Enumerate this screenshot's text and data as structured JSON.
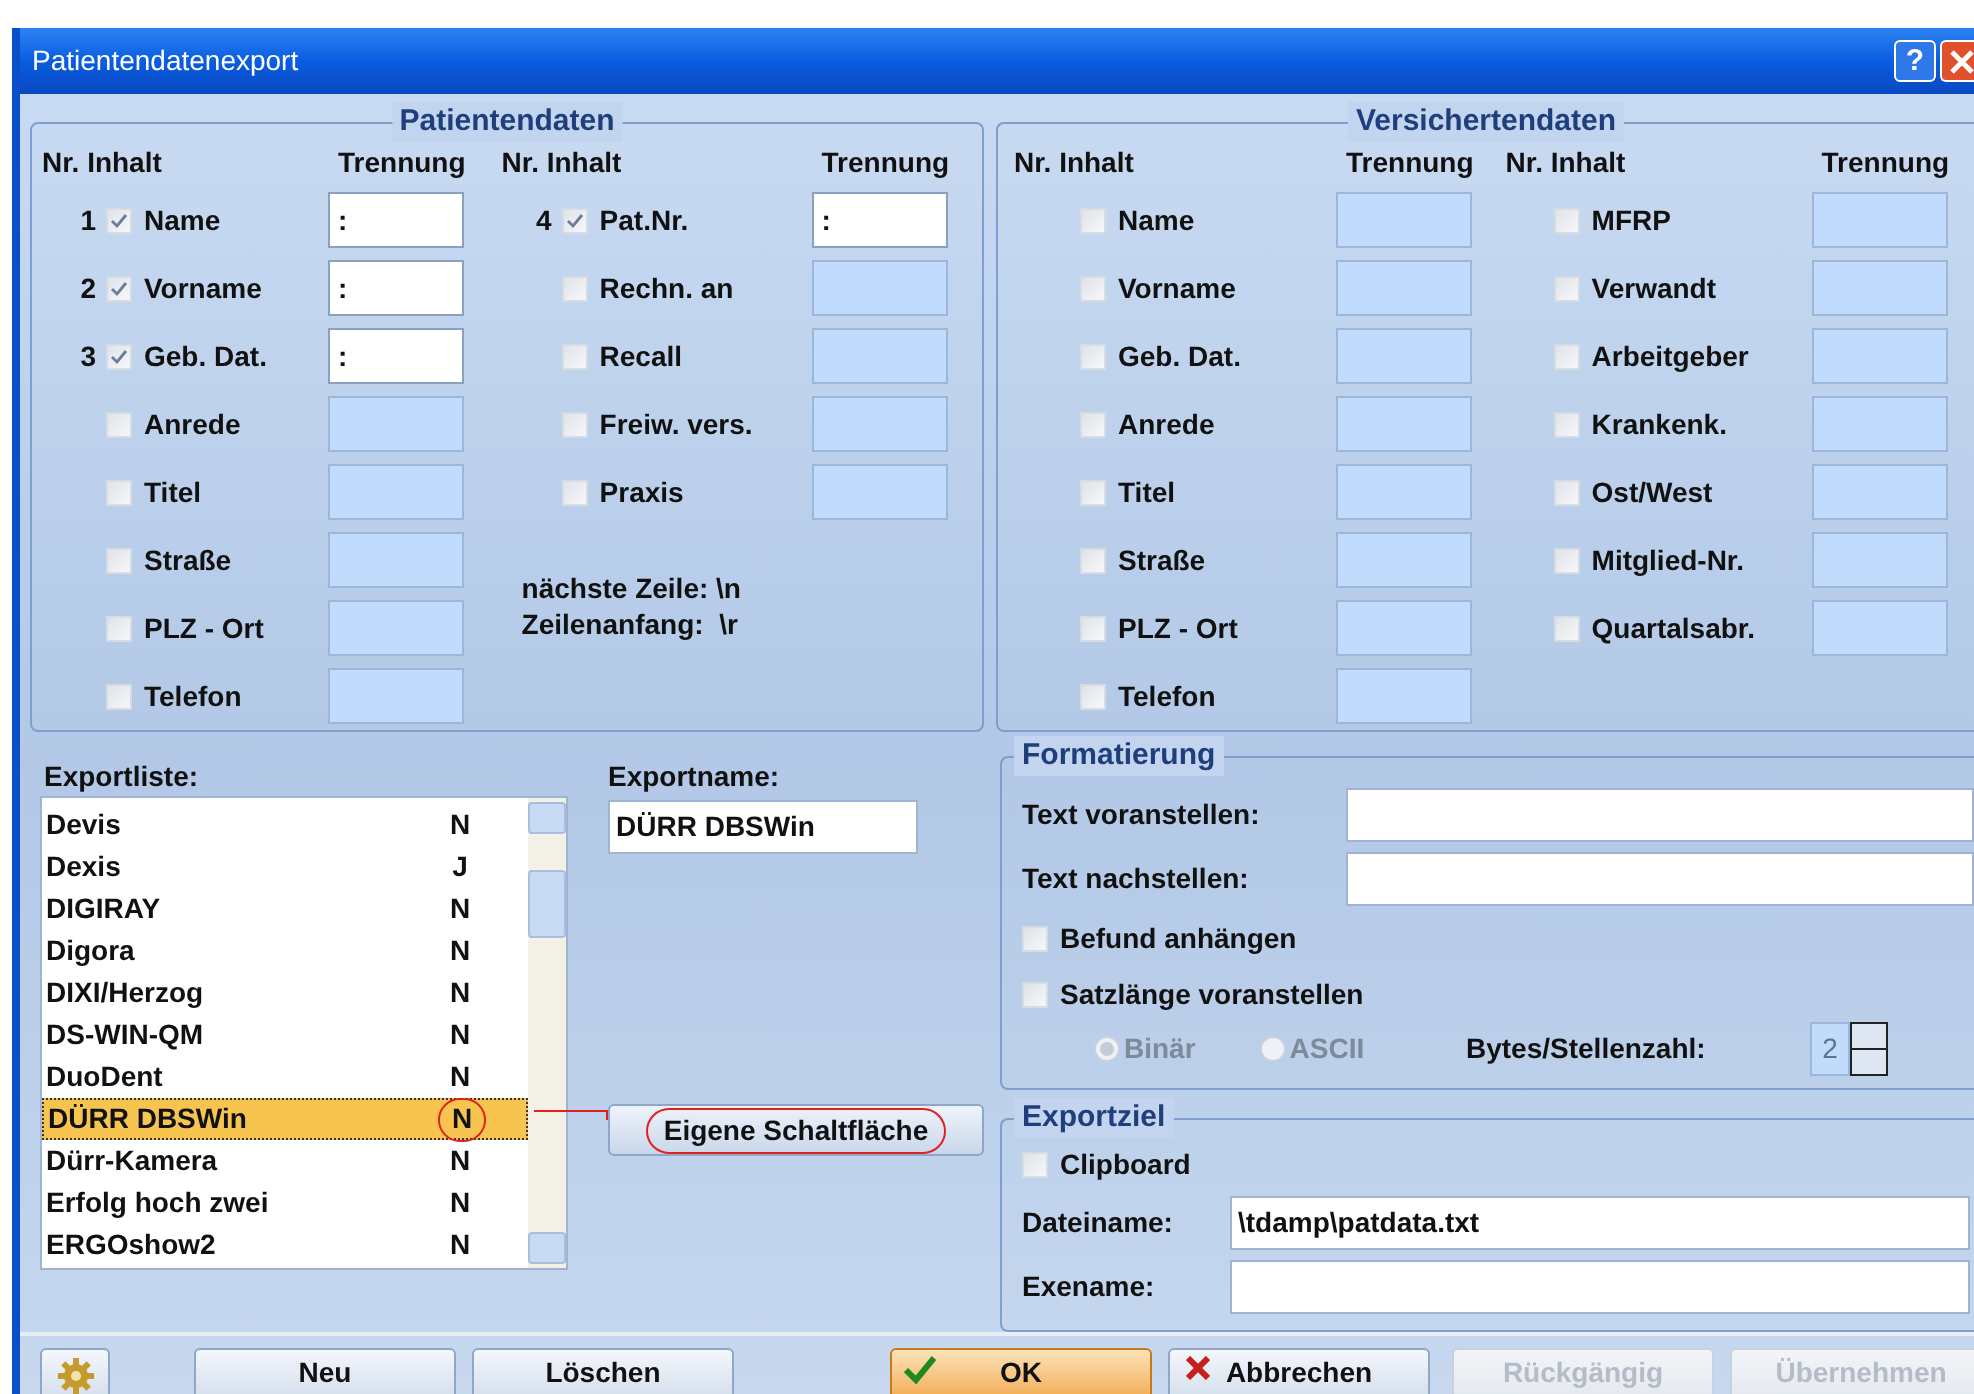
{
  "window": {
    "title": "Patientendatenexport",
    "help": "?"
  },
  "patientendaten": {
    "title": "Patientendaten",
    "headers": [
      {
        "inhalt": "Nr. Inhalt",
        "trennung": "Trennung"
      },
      {
        "inhalt": "Nr. Inhalt",
        "trennung": "Trennung"
      }
    ],
    "columns": [
      [
        {
          "nr": "1",
          "label": "Name",
          "checked": true,
          "enabled": true,
          "separator": ":"
        },
        {
          "nr": "2",
          "label": "Vorname",
          "checked": true,
          "enabled": true,
          "separator": ":"
        },
        {
          "nr": "3",
          "label": "Geb. Dat.",
          "checked": true,
          "enabled": true,
          "separator": ":"
        },
        {
          "label": "Anrede",
          "checked": false,
          "enabled": false
        },
        {
          "label": "Titel",
          "checked": false,
          "enabled": false
        },
        {
          "label": "Straße",
          "checked": false,
          "enabled": false
        },
        {
          "label": "PLZ - Ort",
          "checked": false,
          "enabled": false
        },
        {
          "label": "Telefon",
          "checked": false,
          "enabled": false
        }
      ],
      [
        {
          "nr": "4",
          "label": "Pat.Nr.",
          "checked": true,
          "enabled": true,
          "separator": ":"
        },
        {
          "label": "Rechn. an",
          "checked": false,
          "enabled": false
        },
        {
          "label": "Recall",
          "checked": false,
          "enabled": false
        },
        {
          "label": "Freiw. vers.",
          "checked": false,
          "enabled": false
        },
        {
          "label": "Praxis",
          "checked": false,
          "enabled": false
        }
      ]
    ],
    "notes": [
      "nächste Zeile: \\n",
      "Zeilenanfang:  \\r"
    ]
  },
  "versichertendaten": {
    "title": "Versichertendaten",
    "headers": [
      {
        "inhalt": "Nr. Inhalt",
        "trennung": "Trennung"
      },
      {
        "inhalt": "Nr. Inhalt",
        "trennung": "Trennung"
      }
    ],
    "columns": [
      [
        {
          "label": "Name",
          "checked": false,
          "enabled": false
        },
        {
          "label": "Vorname",
          "checked": false,
          "enabled": false
        },
        {
          "label": "Geb. Dat.",
          "checked": false,
          "enabled": false
        },
        {
          "label": "Anrede",
          "checked": false,
          "enabled": false
        },
        {
          "label": "Titel",
          "checked": false,
          "enabled": false
        },
        {
          "label": "Straße",
          "checked": false,
          "enabled": false
        },
        {
          "label": "PLZ - Ort",
          "checked": false,
          "enabled": false
        },
        {
          "label": "Telefon",
          "checked": false,
          "enabled": false
        }
      ],
      [
        {
          "label": "MFRP",
          "checked": false,
          "enabled": false
        },
        {
          "label": "Verwandt",
          "checked": false,
          "enabled": false
        },
        {
          "label": "Arbeitgeber",
          "checked": false,
          "enabled": false
        },
        {
          "label": "Krankenk.",
          "checked": false,
          "enabled": false
        },
        {
          "label": "Ost/West",
          "checked": false,
          "enabled": false
        },
        {
          "label": "Mitglied-Nr.",
          "checked": false,
          "enabled": false
        },
        {
          "label": "Quartalsabr.",
          "checked": false,
          "enabled": false
        }
      ]
    ]
  },
  "exportliste": {
    "label": "Exportliste:",
    "items": [
      {
        "name": "Devis",
        "flag": "N",
        "selected": false,
        "circled": false
      },
      {
        "name": "Dexis",
        "flag": "J",
        "selected": false,
        "circled": false
      },
      {
        "name": "DIGIRAY",
        "flag": "N",
        "selected": false,
        "circled": false
      },
      {
        "name": "Digora",
        "flag": "N",
        "selected": false,
        "circled": false
      },
      {
        "name": "DIXI/Herzog",
        "flag": "N",
        "selected": false,
        "circled": false
      },
      {
        "name": "DS-WIN-QM",
        "flag": "N",
        "selected": false,
        "circled": false
      },
      {
        "name": "DuoDent",
        "flag": "N",
        "selected": false,
        "circled": false
      },
      {
        "name": "DÜRR DBSWin",
        "flag": "N",
        "selected": true,
        "circled": true
      },
      {
        "name": "Dürr-Kamera",
        "flag": "N",
        "selected": false,
        "circled": false
      },
      {
        "name": "Erfolg hoch zwei",
        "flag": "N",
        "selected": false,
        "circled": false
      },
      {
        "name": "ERGOshow2",
        "flag": "N",
        "selected": false,
        "circled": false
      }
    ]
  },
  "exportname": {
    "label": "Exportname:",
    "value": "DÜRR DBSWin"
  },
  "custom_button": {
    "label": "Eigene Schaltfläche",
    "circled": true
  },
  "formatierung": {
    "title": "Formatierung",
    "fields": [
      {
        "label": "Text voranstellen:"
      },
      {
        "label": "Text nachstellen:"
      }
    ],
    "checkboxes": [
      {
        "label": "Befund anhängen",
        "checked": false
      },
      {
        "label": "Satzlänge voranstellen",
        "checked": false
      }
    ],
    "radios": [
      {
        "label": "Binär",
        "selected": true,
        "disabled": true
      },
      {
        "label": "ASCII",
        "selected": false,
        "disabled": true
      }
    ],
    "bytes": {
      "label": "Bytes/Stellenzahl:",
      "value": "2",
      "disabled": true
    }
  },
  "exportziel": {
    "title": "Exportziel",
    "clipboard": {
      "label": "Clipboard",
      "checked": false
    },
    "fields": [
      {
        "label": "Dateiname:",
        "value": "\\tdamp\\patdata.txt"
      },
      {
        "label": "Exename:"
      }
    ]
  },
  "buttons": [
    {
      "kind": "gear",
      "disabled": false
    },
    {
      "kind": "plain",
      "label": "Neu",
      "disabled": false
    },
    {
      "kind": "plain",
      "label": "Löschen",
      "disabled": false
    },
    {
      "kind": "ok",
      "label": "OK",
      "disabled": false
    },
    {
      "kind": "cancel",
      "label": "Abbrechen",
      "disabled": false
    },
    {
      "kind": "plain",
      "label": "Rückgängig",
      "disabled": true
    },
    {
      "kind": "plain",
      "label": "Übernehmen",
      "disabled": true
    }
  ]
}
